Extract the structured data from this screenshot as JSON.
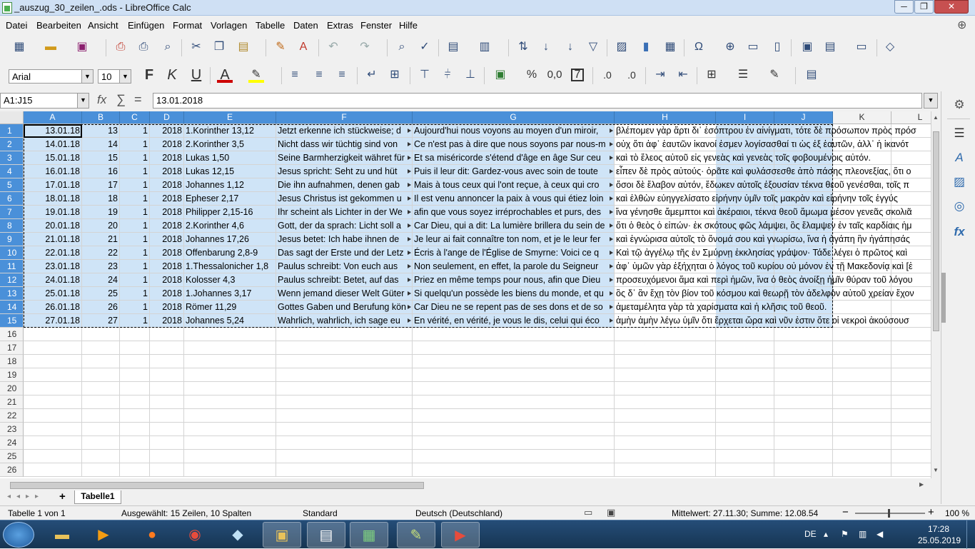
{
  "window": {
    "title": "_auszug_30_zeilen_.ods - LibreOffice Calc",
    "minimize": "─",
    "maximize": "❐",
    "close": "✕"
  },
  "menu": [
    "Datei",
    "Bearbeiten",
    "Ansicht",
    "Einfügen",
    "Format",
    "Vorlagen",
    "Tabelle",
    "Daten",
    "Extras",
    "Fenster",
    "Hilfe"
  ],
  "format": {
    "font": "Arial",
    "size": "10"
  },
  "formula": {
    "name_box": "A1:J15",
    "fx": "fx",
    "sum": "∑",
    "eq": "=",
    "content": "13.01.2018"
  },
  "columns": [
    "A",
    "B",
    "C",
    "D",
    "E",
    "F",
    "G",
    "H",
    "I",
    "J",
    "K",
    "L"
  ],
  "rows": [
    [
      "13.01.18",
      "13",
      "1",
      "2018",
      "1.Korinther 13,12",
      "Jetzt erkenne ich stückweise; d",
      "Aujourd'hui nous voyons au moyen d'un miroir, ",
      "βλέπομεν γὰρ ἄρτι δι᾽ ἐσόπτρου ἐν αἰνίγματι, τότε δὲ πρόσωπον πρὸς πρόσ"
    ],
    [
      "14.01.18",
      "14",
      "1",
      "2018",
      "2.Korinther 3,5",
      "Nicht dass wir tüchtig sind von",
      "Ce n'est pas à dire que nous soyons par nous-m",
      "οὐχ ὅτι ἀφ᾽ ἑαυτῶν ἱκανοί ἐσμεν λογίσασθαί τι ὡς ἐξ ἑαυτῶν, ἀλλ᾽ ἡ ἱκανότ"
    ],
    [
      "15.01.18",
      "15",
      "1",
      "2018",
      "Lukas 1,50",
      "Seine Barmherzigkeit währet für",
      "Et sa miséricorde s'étend d'âge en âge Sur ceu",
      "καὶ τὸ ἔλεος αὐτοῦ εἰς γενεὰς καὶ γενεὰς τοῖς φοβουμένοις αὐτόν."
    ],
    [
      "16.01.18",
      "16",
      "1",
      "2018",
      "Lukas 12,15",
      " Jesus spricht: Seht zu und hüt",
      "Puis il leur dit: Gardez-vous avec soin de toute ",
      "εἶπεν δὲ πρὸς αὐτούς· ὁρᾶτε καὶ φυλάσσεσθε ἀπὸ πάσης πλεονεξίας, ὅτι ο"
    ],
    [
      "17.01.18",
      "17",
      "1",
      "2018",
      "Johannes 1,12",
      "Die ihn aufnahmen, denen gab",
      "Mais à tous ceux qui l'ont reçue, à ceux qui cro",
      "ὅσοι δὲ ἔλαβον αὐτόν, ἔδωκεν αὐτοῖς ἐξουσίαν τέκνα θεοῦ γενέσθαι, τοῖς π"
    ],
    [
      "18.01.18",
      "18",
      "1",
      "2018",
      "Epheser 2,17",
      "Jesus Christus ist gekommen u",
      "Il est venu annoncer la paix à vous qui étiez loin",
      "καὶ ἐλθὼν εὐηγγελίσατο εἰρήνην ὑμῖν τοῖς μακρὰν καὶ εἰρήνην τοῖς ἐγγύς"
    ],
    [
      "19.01.18",
      "19",
      "1",
      "2018",
      "Philipper 2,15-16",
      "Ihr scheint als Lichter in der We",
      "afin que vous soyez irréprochables et purs, des",
      "ἵνα γένησθε ἄμεμπτοι καὶ ἀκέραιοι, τέκνα θεοῦ ἄμωμα μέσον γενεᾶς σκολιᾶ"
    ],
    [
      "20.01.18",
      "20",
      "1",
      "2018",
      "2.Korinther 4,6",
      "Gott, der da sprach: Licht soll a",
      "Car Dieu, qui a dit: La lumière brillera du sein de",
      "ὅτι ὁ θεὸς ὁ εἰπών· ἐκ σκότους φῶς λάμψει, ὃς ἔλαμψεν ἐν ταῖς καρδίαις ἡμ"
    ],
    [
      "21.01.18",
      "21",
      "1",
      "2018",
      "Johannes 17,26",
      " Jesus betet: Ich habe ihnen de",
      "Je leur ai fait connaître ton nom, et je le leur fer",
      "καὶ ἐγνώρισα αὐτοῖς τὸ ὄνομά σου καὶ γνωρίσω, ἵνα ἡ ἀγάπη ἣν ἠγάπησάς"
    ],
    [
      "22.01.18",
      "22",
      "1",
      "2018",
      "Offenbarung 2,8-9",
      "Das sagt der Erste und der Letz",
      "Écris à l'ange de l'Église de Smyrne: Voici ce q",
      "Καὶ τῷ ἀγγέλῳ τῆς ἐν Σμύρνῃ ἐκκλησίας γράψον· Τάδε λέγει ὁ πρῶτος καὶ"
    ],
    [
      "23.01.18",
      "23",
      "1",
      "2018",
      "1.Thessalonicher 1,8",
      " Paulus schreibt: Von euch aus",
      "Non seulement, en effet, la parole du Seigneur ",
      "ἀφ᾽ ὑμῶν γὰρ ἐξήχηται ὁ λόγος τοῦ κυρίου οὐ μόνον ἐν τῇ Μακεδονίᾳ καὶ [ἐ"
    ],
    [
      "24.01.18",
      "24",
      "1",
      "2018",
      "Kolosser 4,3",
      " Paulus schreibt: Betet, auf das",
      "Priez en même temps pour nous, afin que Dieu ",
      "προσευχόμενοι ἅμα καὶ περὶ ἡμῶν, ἵνα ὁ θεὸς ἀνοίξῃ ἡμῖν θύραν τοῦ λόγου"
    ],
    [
      "25.01.18",
      "25",
      "1",
      "2018",
      "1.Johannes 3,17",
      "Wenn jemand dieser Welt Güter",
      "Si quelqu'un possède les biens du monde, et qu",
      "ὃς δ᾽ ἂν ἔχῃ τὸν βίον τοῦ κόσμου καὶ θεωρῇ τὸν ἀδελφὸν αὐτοῦ χρείαν ἔχον"
    ],
    [
      "26.01.18",
      "26",
      "1",
      "2018",
      "Römer 11,29",
      "Gottes Gaben und Berufung kön",
      "Car Dieu ne se repent pas de ses dons et de so",
      "ἀμεταμέλητα γὰρ τὰ χαρίσματα καὶ ἡ κλῆσις τοῦ θεοῦ."
    ],
    [
      "27.01.18",
      "27",
      "1",
      "2018",
      "Johannes 5,24",
      "Wahrlich, wahrlich, ich sage eu",
      "En vérité, en vérité, je vous le dis, celui qui éco",
      "ἀμὴν ἀμὴν λέγω ὑμῖν ὅτι ἔρχεται ὥρα καὶ νῦν ἐστιν ὅτε οἱ νεκροὶ ἀκούσουσ"
    ]
  ],
  "empty_rows": [
    "16",
    "17",
    "18",
    "19",
    "20",
    "21",
    "22",
    "23",
    "24",
    "25",
    "26"
  ],
  "sheet": {
    "add": "+",
    "tab": "Tabelle1"
  },
  "status": {
    "sheet": "Tabelle 1 von 1",
    "selection": "Ausgewählt: 15 Zeilen, 10 Spalten",
    "style": "Standard",
    "language": "Deutsch (Deutschland)",
    "stats": "Mittelwert: 27.11.30; Summe: 12.08.54",
    "zoom": "100 %"
  },
  "taskbar": {
    "lang": "DE",
    "time": "17:28",
    "date": "25.05.2019"
  },
  "colors": {
    "header_selected": "#4a90d9",
    "cell_selected": "#cfe4f7",
    "taskbar": "#1e4266"
  }
}
